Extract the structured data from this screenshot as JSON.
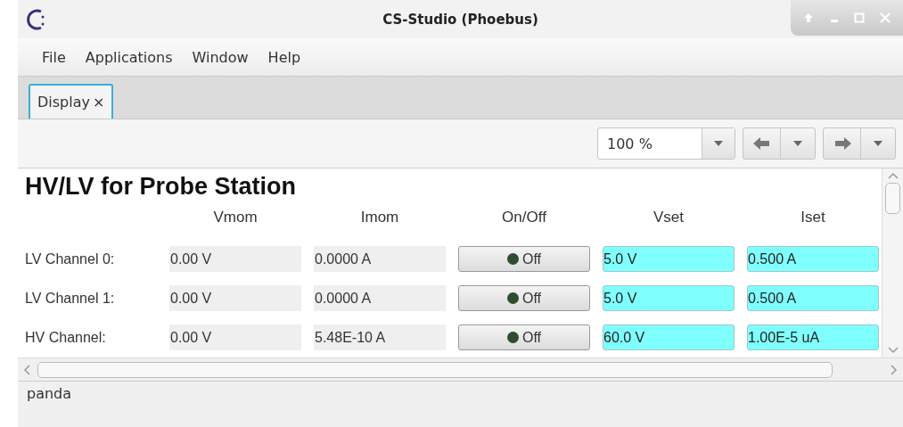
{
  "window": {
    "title": "CS-Studio (Phoebus)"
  },
  "menu": [
    "File",
    "Applications",
    "Window",
    "Help"
  ],
  "tabs": [
    {
      "label": "Display",
      "close": "×",
      "selected": true
    }
  ],
  "toolbar": {
    "zoom": "100 %"
  },
  "display": {
    "title": "HV/LV for Probe Station",
    "columns": [
      "Vmom",
      "Imom",
      "On/Off",
      "Vset",
      "Iset"
    ],
    "channels": [
      {
        "name": "LV Channel 0:",
        "vmom": "0.00 V",
        "imom": "0.0000 A",
        "button": "Off",
        "on": false,
        "vset": "5.0 V",
        "iset": "0.500 A"
      },
      {
        "name": "LV Channel 1:",
        "vmom": "0.00 V",
        "imom": "0.0000 A",
        "button": "Off",
        "on": false,
        "vset": "5.0 V",
        "iset": "0.500 A"
      },
      {
        "name": "HV Channel:",
        "vmom": "0.00 V",
        "imom": "5.48E-10 A",
        "button": "Off",
        "on": false,
        "vset": "60.0 V",
        "iset": "1.00E-5 uA"
      }
    ]
  },
  "status_bar": "panda"
}
